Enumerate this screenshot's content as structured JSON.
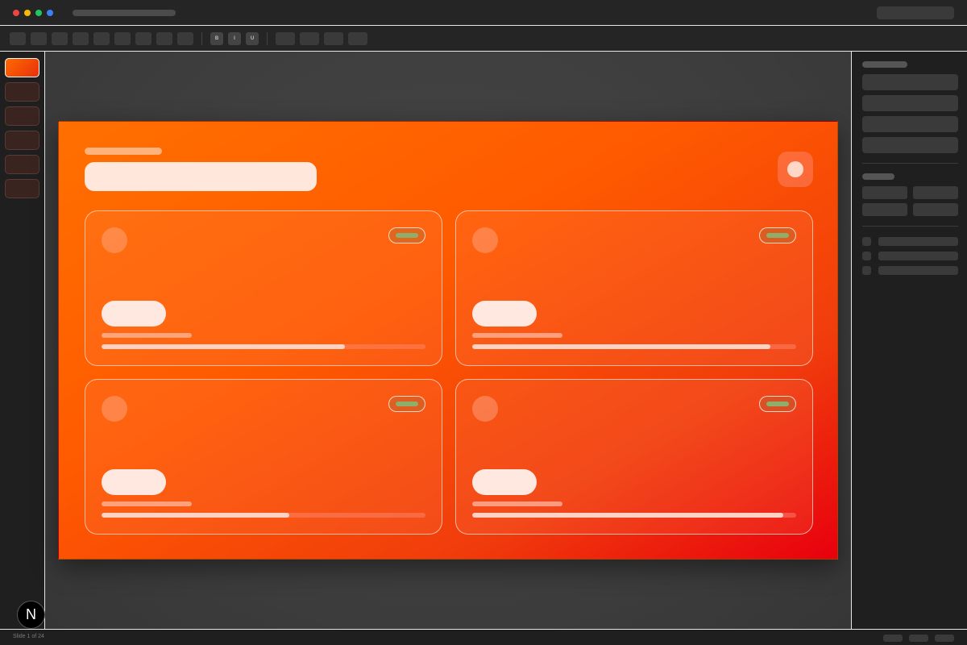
{
  "titlebar": {
    "traffic_lights": [
      "#ef4444",
      "#f5b800",
      "#22c55e",
      "#3b82f6"
    ]
  },
  "toolbar": {
    "format_buttons": [
      "B",
      "I",
      "U"
    ]
  },
  "slide_rail": {
    "slide_count": 6,
    "active_index": 0
  },
  "slide": {
    "gradient": [
      "#ff7000",
      "#ff5a00",
      "#f03c0c",
      "#e8000e"
    ],
    "cards": [
      {
        "progress": 0.75
      },
      {
        "progress": 0.92
      },
      {
        "progress": 0.58
      },
      {
        "progress": 0.96
      }
    ]
  },
  "statusbar": {
    "slide_label": "Slide 1 of 24"
  },
  "logo": {
    "letter": "N"
  },
  "colors": {
    "accent": "#ff5a00",
    "badge_indicator": "#8fae6b"
  },
  "icons": [
    "traffic-light-icon",
    "bold-icon",
    "italic-icon",
    "underline-icon",
    "logo-icon"
  ]
}
